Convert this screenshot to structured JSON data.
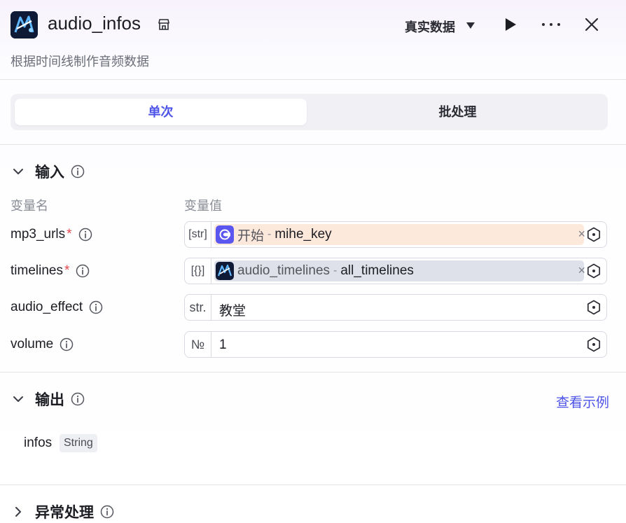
{
  "header": {
    "title": "audio_infos",
    "subtitle": "根据时间线制作音频数据",
    "mode_label": "真实数据",
    "icons": {
      "logo": "plugin-logo-icon",
      "store": "store-icon",
      "mode": "caret-down-icon",
      "run": "play-icon",
      "more": "more-icon",
      "close": "close-icon"
    }
  },
  "tabs": [
    {
      "label": "单次",
      "active": true
    },
    {
      "label": "批处理",
      "active": false
    }
  ],
  "input_section": {
    "title": "输入",
    "col_name": "变量名",
    "col_value": "变量值",
    "rows": [
      {
        "name": "mp3_urls",
        "required": "*",
        "type_icon": "[str]",
        "ref_source": "开始",
        "ref_sep": "-",
        "ref_var": "mihe_key",
        "clear": "×"
      },
      {
        "name": "timelines",
        "required": "*",
        "type_icon": "[{}]",
        "ref_source": "audio_timelines",
        "ref_sep": "-",
        "ref_var": "all_timelines",
        "clear": "×"
      },
      {
        "name": "audio_effect",
        "type_icon": "str.",
        "value": "教堂"
      },
      {
        "name": "volume",
        "type_icon": "№",
        "value": "1"
      }
    ]
  },
  "output_section": {
    "title": "输出",
    "example_link": "查看示例",
    "outputs": [
      {
        "name": "infos",
        "type": "String"
      }
    ]
  },
  "error_section": {
    "title": "异常处理"
  },
  "colors": {
    "accent": "#4d53e8",
    "required": "#e5484d",
    "ref_orange": "#fde8dc",
    "ref_slate": "#dfe1ea",
    "start_node": "#5b56ef"
  }
}
